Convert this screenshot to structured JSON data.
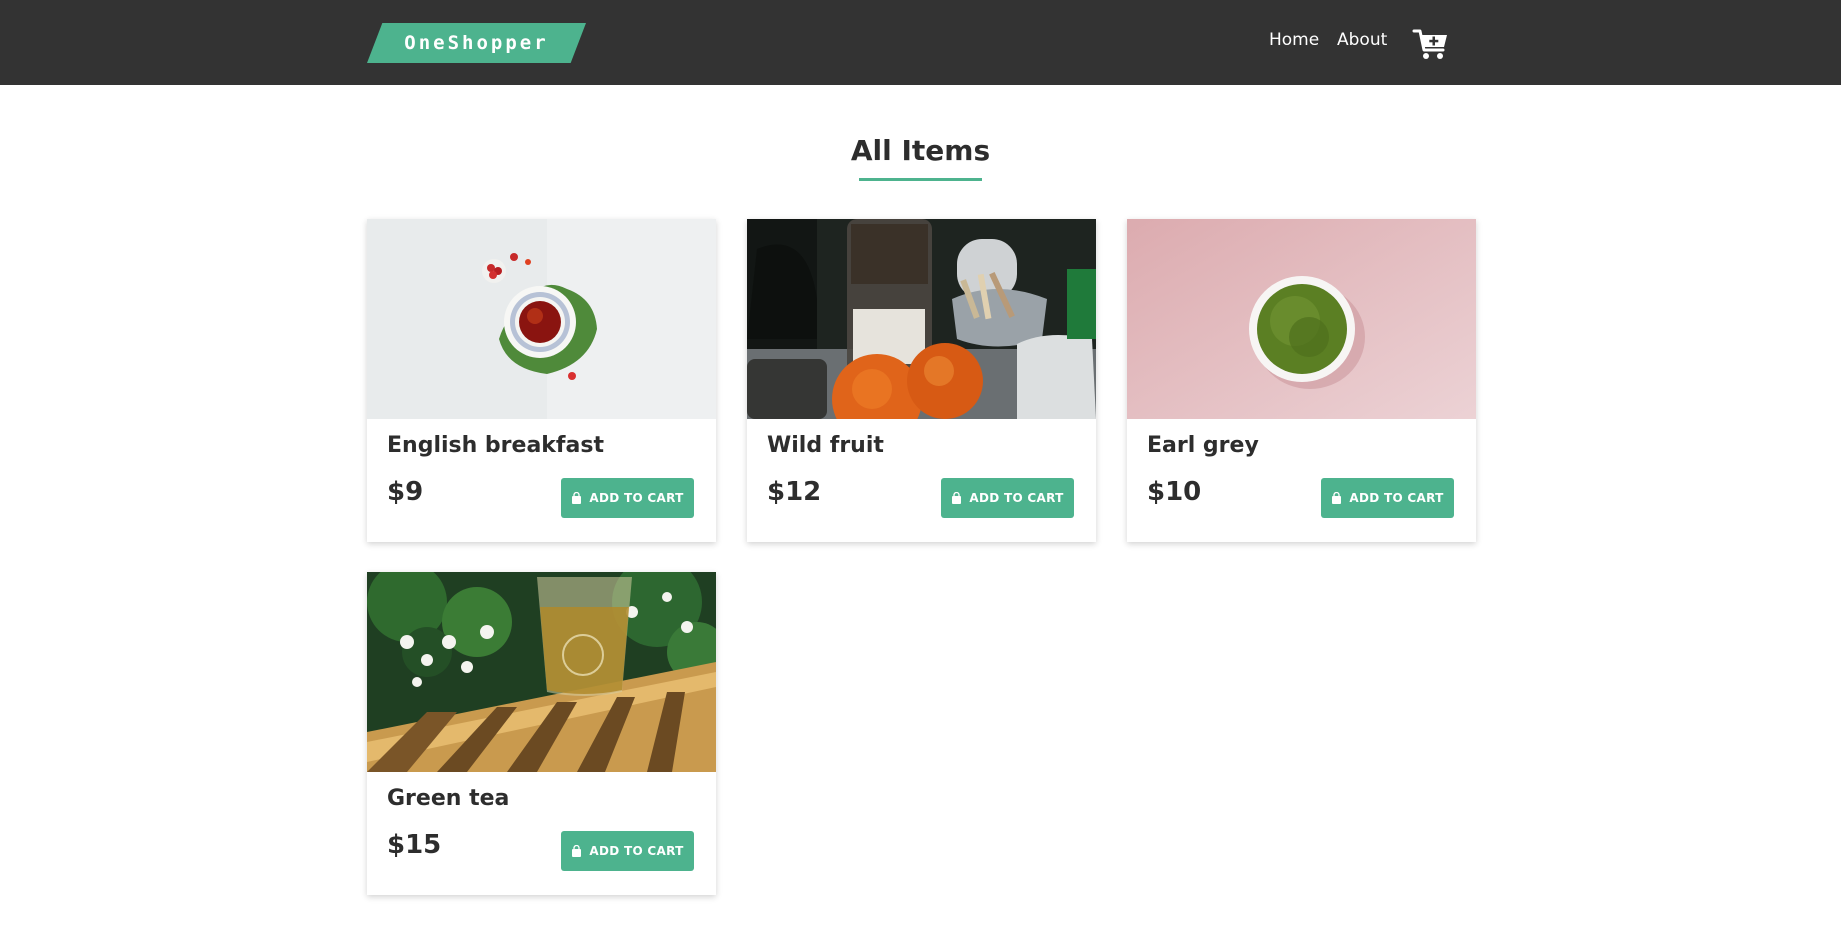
{
  "brand": {
    "name": "OneShopper",
    "color": "#4db38e"
  },
  "nav": {
    "home_label": "Home",
    "about_label": "About",
    "cart_icon": "cart-plus-icon"
  },
  "main": {
    "title": "All Items"
  },
  "products": [
    {
      "name": "English breakfast",
      "price": "$9",
      "button_label": "ADD TO CART",
      "image": "tea-cup-on-leaf"
    },
    {
      "name": "Wild fruit",
      "price": "$12",
      "button_label": "ADD TO CART",
      "image": "granola-jar-oranges"
    },
    {
      "name": "Earl grey",
      "price": "$10",
      "button_label": "ADD TO CART",
      "image": "matcha-bowl-pink"
    },
    {
      "name": "Green tea",
      "price": "$15",
      "button_label": "ADD TO CART",
      "image": "glass-tea-bamboo-tray"
    }
  ],
  "colors": {
    "navbar": "#333333",
    "accent": "#4db38e",
    "text": "#2d2d2d"
  }
}
